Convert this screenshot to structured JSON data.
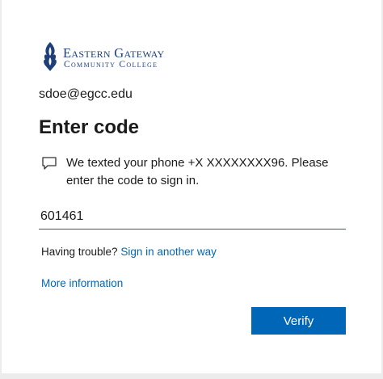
{
  "logo": {
    "line1": "Eastern Gateway",
    "line2": "Community College"
  },
  "account": {
    "email": "sdoe@egcc.edu"
  },
  "heading": "Enter code",
  "message": "We texted your phone +X XXXXXXXX96. Please enter the code to sign in.",
  "code_input": {
    "value": "601461"
  },
  "trouble": {
    "prefix": "Having trouble?",
    "link": "Sign in another way"
  },
  "more_info": "More information",
  "verify_button": "Verify",
  "colors": {
    "accent": "#0067b8",
    "brand": "#1f3f7a"
  }
}
